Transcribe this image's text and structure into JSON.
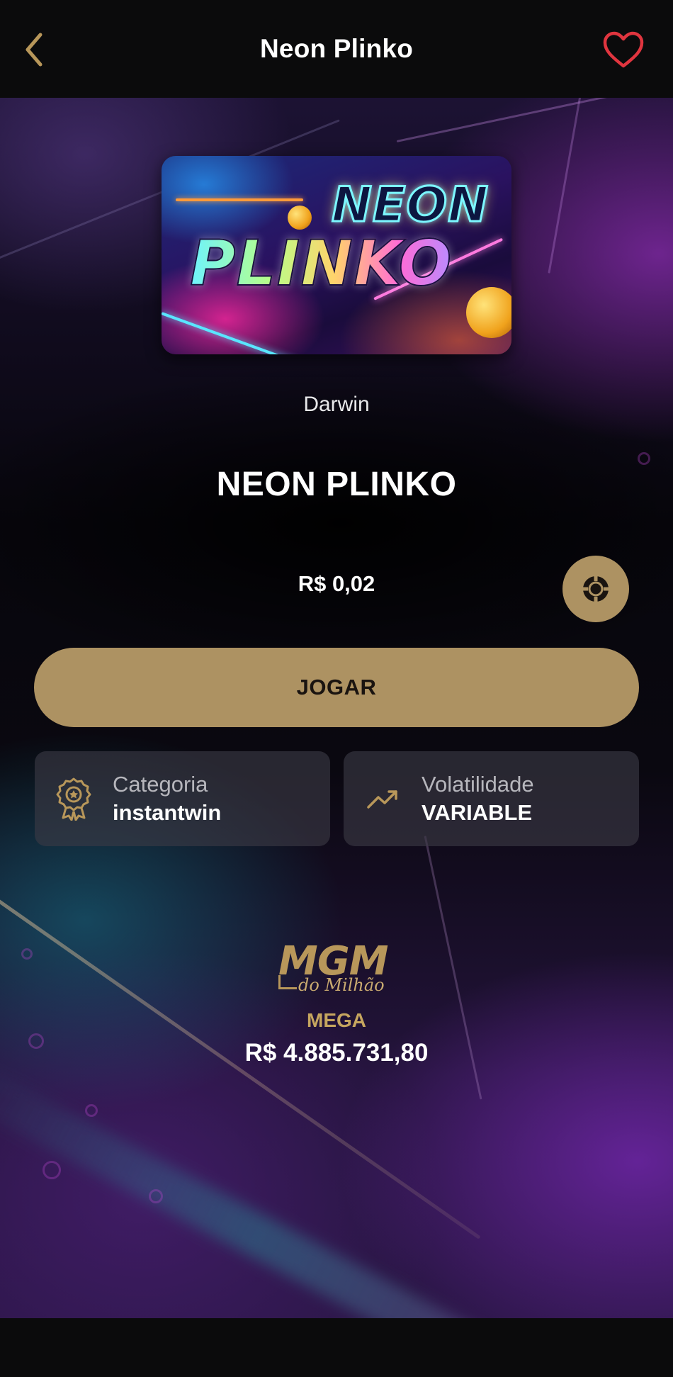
{
  "header": {
    "title": "Neon Plinko",
    "back_icon": "chevron-left-icon",
    "favorite_icon": "heart-outline-icon"
  },
  "game": {
    "thumbnail_line1": "NEON",
    "thumbnail_line2": "PLINKO",
    "provider": "Darwin",
    "name": "NEON PLINKO",
    "price": "R$ 0,02",
    "add_chip_icon": "poker-chip-icon",
    "play_label": "JOGAR"
  },
  "info_cards": {
    "category": {
      "label": "Categoria",
      "value": "instantwin",
      "icon": "award-badge-icon"
    },
    "volatility": {
      "label": "Volatilidade",
      "value": "VARIABLE",
      "icon": "trending-up-icon"
    }
  },
  "jackpot": {
    "brand": "MGM",
    "brand_sub": "do Milhão",
    "tier": "MEGA",
    "amount": "R$ 4.885.731,80"
  },
  "colors": {
    "accent_gold": "#ad9262",
    "favorite_red": "#e0353f",
    "card_bg": "#3c3a46"
  }
}
